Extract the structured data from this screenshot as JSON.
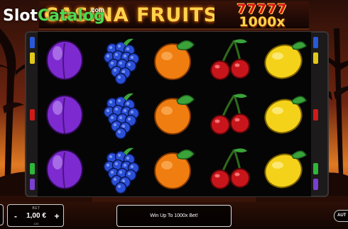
{
  "header": {
    "title": "CASINA FRUITS",
    "jackpot_sevens": "77777",
    "jackpot_multiplier": "1000x"
  },
  "watermark": {
    "part1": "Slot",
    "part2": "Catalog",
    "suffix": ".com"
  },
  "reels": [
    [
      "plum",
      "plum",
      "plum"
    ],
    [
      "grapes",
      "grapes",
      "grapes"
    ],
    [
      "orange",
      "orange",
      "orange"
    ],
    [
      "cherry",
      "cherry",
      "cherry"
    ],
    [
      "lemon",
      "lemon",
      "lemon"
    ]
  ],
  "symbols": {
    "plum": {
      "icon": "plum-icon",
      "color": "#7d2ad1"
    },
    "grapes": {
      "icon": "grapes-icon",
      "color": "#2b4fd6"
    },
    "orange": {
      "icon": "orange-icon",
      "color": "#f07d10"
    },
    "cherry": {
      "icon": "cherry-icon",
      "color": "#c8151c"
    },
    "lemon": {
      "icon": "lemon-icon",
      "color": "#f5d21a"
    }
  },
  "paylines": {
    "left": [
      "#2a59d8",
      "#e0c81a",
      "#cf1a1a",
      "#2fb53a",
      "#7a3fd0"
    ],
    "right": [
      "#2a59d8",
      "#e0c81a",
      "#cf1a1a",
      "#2fb53a",
      "#7a3fd0"
    ]
  },
  "bet": {
    "label": "BET",
    "value": "1,00 €",
    "sub": "100",
    "minus_label": "-",
    "plus_label": "+"
  },
  "message": "Win Up To 1000x Bet!",
  "auto_label": "AUT"
}
